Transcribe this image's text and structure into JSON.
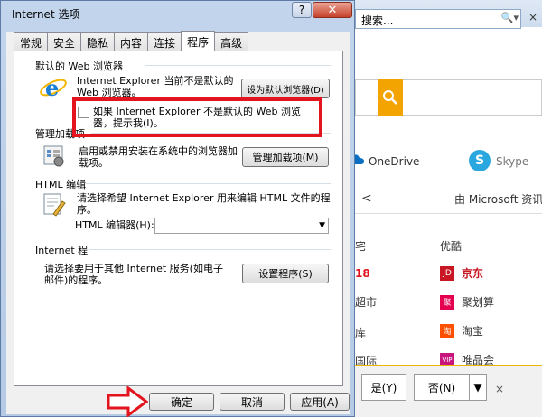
{
  "background": {
    "search_placeholder": "搜索...",
    "onedrive_label": "OneDrive",
    "skype_label": "Skype",
    "from_microsoft": "由 Microsoft 资讯赋",
    "left_col": [
      "宅",
      "18",
      "超市",
      "库",
      "国际"
    ],
    "offers_title": "优酷",
    "offers": [
      {
        "label": "京东",
        "color": "#c81623",
        "logo": "JD"
      },
      {
        "label": "聚划算",
        "color": "#e5004f",
        "logo": "聚"
      },
      {
        "label": "淘宝",
        "color": "#ff5000",
        "logo": "淘"
      },
      {
        "label": "唯品会",
        "color": "#c8157e",
        "logo": "VIP"
      }
    ],
    "notify_yes": "是(Y)",
    "notify_no": "否(N)"
  },
  "dialog": {
    "title": "Internet 选项",
    "help_label": "?",
    "close_label": "✕",
    "tabs": [
      "常规",
      "安全",
      "隐私",
      "内容",
      "连接",
      "程序",
      "高级"
    ],
    "active_tab": "程序",
    "default_browser": {
      "title": "默认的 Web 浏览器",
      "status": "Internet Explorer 当前不是默认的 Web 浏览器。",
      "set_default_button": "设为默认浏览器(D)",
      "checkbox_label": "如果 Internet Explorer 不是默认的 Web 浏览器，提示我(I)。"
    },
    "addons": {
      "title": "管理加载项",
      "description": "启用或禁用安装在系统中的浏览器加载项。",
      "button": "管理加载项(M)"
    },
    "html_editing": {
      "title": "HTML 编辑",
      "description": "请选择希望 Internet Explorer 用来编辑 HTML 文件的程序。",
      "editor_label": "HTML 编辑器(H):",
      "editor_value": ""
    },
    "internet_programs": {
      "title": "Internet 程",
      "description": "请选择要用于其他 Internet 服务(如电子邮件)的程序。",
      "button": "设置程序(S)"
    },
    "footer": {
      "ok": "确定",
      "cancel": "取消",
      "apply": "应用(A)"
    }
  },
  "colors": {
    "highlight": "#e3141d",
    "search_accent": "#f4a400",
    "titlebar": "#c2d5ec"
  }
}
